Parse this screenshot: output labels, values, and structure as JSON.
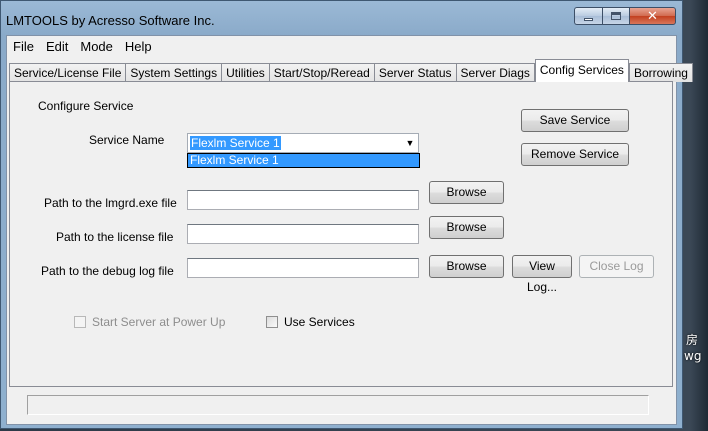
{
  "window": {
    "title": "LMTOOLS by Acresso Software Inc.",
    "controls": {
      "minimize_icon": "minimize-icon",
      "maximize_icon": "maximize-icon",
      "close_glyph": "✕"
    }
  },
  "menu": [
    "File",
    "Edit",
    "Mode",
    "Help"
  ],
  "tabs": [
    {
      "label": "Service/License File",
      "active": false
    },
    {
      "label": "System Settings",
      "active": false
    },
    {
      "label": "Utilities",
      "active": false
    },
    {
      "label": "Start/Stop/Reread",
      "active": false
    },
    {
      "label": "Server Status",
      "active": false
    },
    {
      "label": "Server Diags",
      "active": false
    },
    {
      "label": "Config Services",
      "active": true
    },
    {
      "label": "Borrowing",
      "active": false
    }
  ],
  "config": {
    "section_title": "Configure Service",
    "service_name_label": "Service Name",
    "service_name_value": "Flexlm Service 1",
    "service_name_options": [
      "Flexlm Service 1"
    ],
    "dropdown_arrow": "▼",
    "save_service": "Save Service",
    "remove_service": "Remove Service",
    "lmgrd_label": "Path to the lmgrd.exe file",
    "lmgrd_value": "",
    "license_label": "Path to the license file",
    "license_value": "",
    "debug_log_label": "Path to the debug log file",
    "debug_log_value": "",
    "browse": "Browse",
    "view_log": "View Log...",
    "close_log": "Close Log",
    "start_at_power_up": "Start Server at Power Up",
    "start_at_power_up_checked": false,
    "start_at_power_up_enabled": false,
    "use_services": "Use Services",
    "use_services_checked": false
  },
  "statusbar": {
    "text": ""
  },
  "desktop": {
    "text1": "房",
    "text2": "wg"
  },
  "colors": {
    "selection": "#3399ff",
    "titlebar": "#9bb9d6",
    "close_button": "#c3401f",
    "panel": "#f0f0f0"
  }
}
